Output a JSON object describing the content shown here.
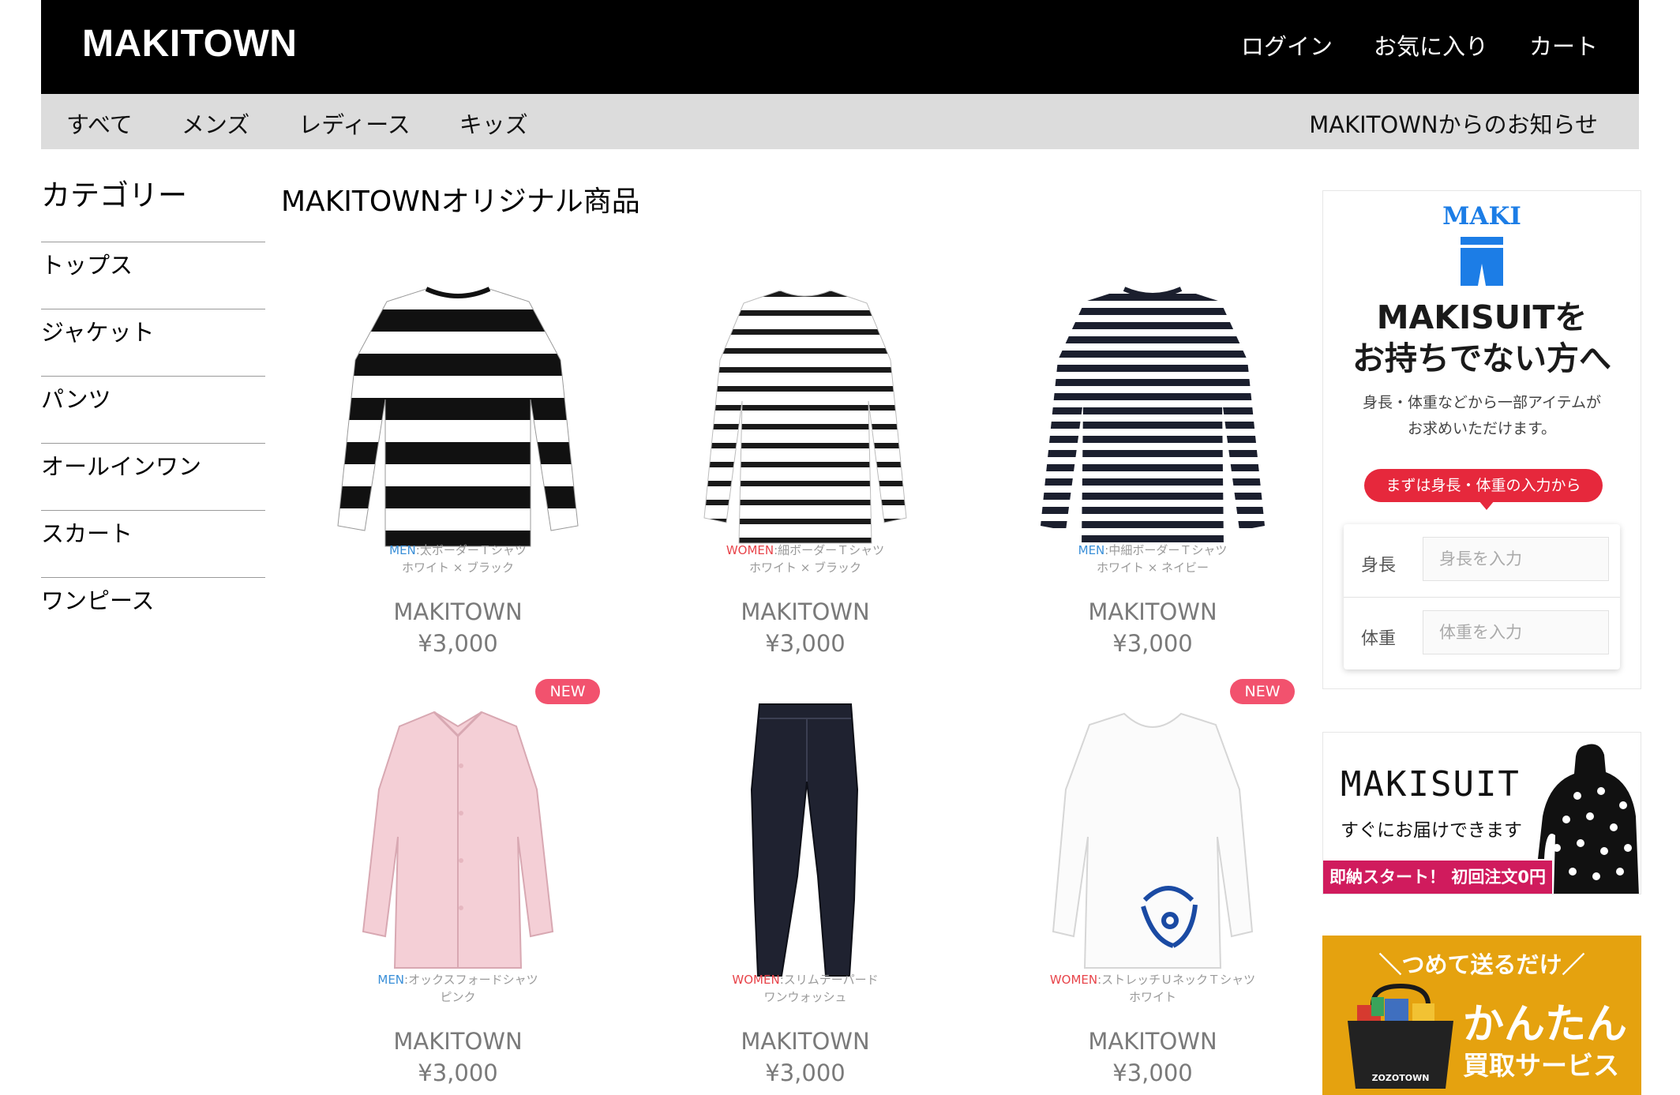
{
  "header": {
    "logo": "MAKITOWN",
    "nav": {
      "login": "ログイン",
      "favorites": "お気に入り",
      "cart": "カート"
    }
  },
  "subnav": {
    "all": "すべて",
    "mens": "メンズ",
    "ladies": "レディース",
    "kids": "キッズ",
    "news": "MAKITOWNからのお知らせ"
  },
  "sidebar": {
    "title": "カテゴリー",
    "categories": [
      "トップス",
      "ジャケット",
      "パンツ",
      "オールインワン",
      "スカート",
      "ワンピース"
    ]
  },
  "main": {
    "title": "MAKITOWNオリジナル商品",
    "products": [
      {
        "gender": "MEN",
        "name": ":太ボーダーＴシャツ",
        "color": "ホワイト × ブラック",
        "brand": "MAKITOWN",
        "price": "¥3,000",
        "badge": ""
      },
      {
        "gender": "WOMEN",
        "name": ":細ボーダーＴシャツ",
        "color": "ホワイト × ブラック",
        "brand": "MAKITOWN",
        "price": "¥3,000",
        "badge": ""
      },
      {
        "gender": "MEN",
        "name": ":中細ボーダーＴシャツ",
        "color": "ホワイト × ネイビー",
        "brand": "MAKITOWN",
        "price": "¥3,000",
        "badge": ""
      },
      {
        "gender": "MEN",
        "name": ":オックスフォードシャツ",
        "color": "ピンク",
        "brand": "MAKITOWN",
        "price": "¥3,000",
        "badge": "NEW"
      },
      {
        "gender": "WOMEN",
        "name": ":スリムテーパード",
        "color": "ワンウォッシュ",
        "brand": "MAKITOWN",
        "price": "¥3,000",
        "badge": ""
      },
      {
        "gender": "WOMEN",
        "name": ":ストレッチＵネックＴシャツ",
        "color": "ホワイト",
        "brand": "MAKITOWN",
        "price": "¥3,000",
        "badge": "NEW"
      }
    ]
  },
  "ads": {
    "makisuit_form": {
      "brand": "MAKI",
      "title_line1": "MAKISUITを",
      "title_line2": "お持ちでない方へ",
      "desc_line1": "身長・体重などから一部アイテムが",
      "desc_line2": "お求めいただけます。",
      "cta": "まずは身長・体重の入力から",
      "height_label": "身長",
      "height_placeholder": "身長を入力",
      "weight_label": "体重",
      "weight_placeholder": "体重を入力"
    },
    "makisuit_delivery": {
      "title": "MAKISUIT",
      "subtitle": "すぐにお届けできます",
      "band": "即納スタート！ 初回注文0円"
    },
    "buyback": {
      "headline": "＼つめて送るだけ／",
      "main": "かんたん",
      "sub": "買取サービス",
      "bag_label": "ZOZOTOWN"
    }
  },
  "colors": {
    "header_bg": "#000000",
    "subnav_bg": "#dcdcdc",
    "men_color": "#3a8fd8",
    "women_color": "#e8444a",
    "badge_color": "#f2526e",
    "cta_color": "#e6283c",
    "maki_blue": "#1c7de6",
    "band_color": "#d01b5d",
    "buyback_bg": "#e5a20f"
  }
}
